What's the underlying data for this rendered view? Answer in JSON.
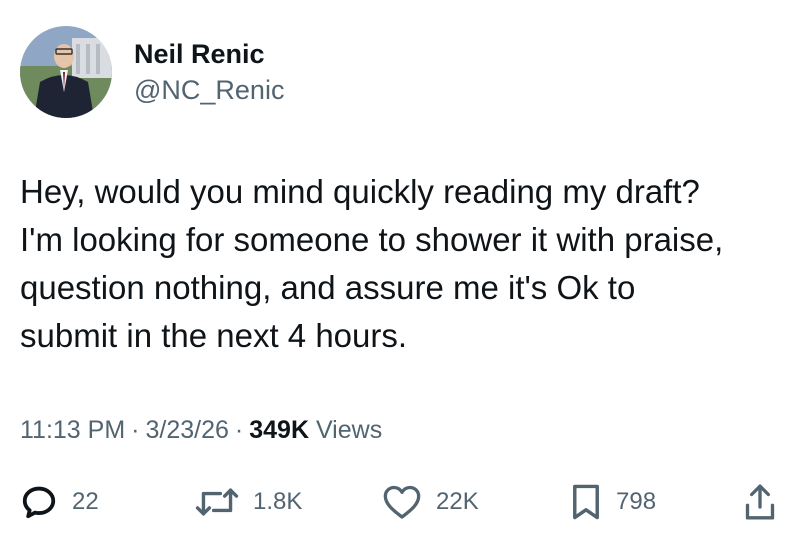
{
  "author": {
    "display_name": "Neil Renic",
    "handle": "@NC_Renic",
    "avatar_icon": "profile-photo"
  },
  "tweet": {
    "text": "Hey, would you mind quickly reading my draft?\nI'm looking for someone to shower it with praise,\nquestion nothing, and assure me it's Ok to\nsubmit in the next 4 hours."
  },
  "meta": {
    "time": "11:13 PM",
    "separator": "·",
    "date": "3/23/26",
    "views_count": "349K",
    "views_label": "Views"
  },
  "actions": {
    "replies": {
      "icon": "reply-icon",
      "count": "22"
    },
    "reposts": {
      "icon": "repost-icon",
      "count": "1.8K"
    },
    "likes": {
      "icon": "heart-icon",
      "count": "22K"
    },
    "bookmarks": {
      "icon": "bookmark-icon",
      "count": "798"
    },
    "share": {
      "icon": "share-icon"
    }
  },
  "colors": {
    "text_primary": "#0f1419",
    "text_secondary": "#536471"
  }
}
